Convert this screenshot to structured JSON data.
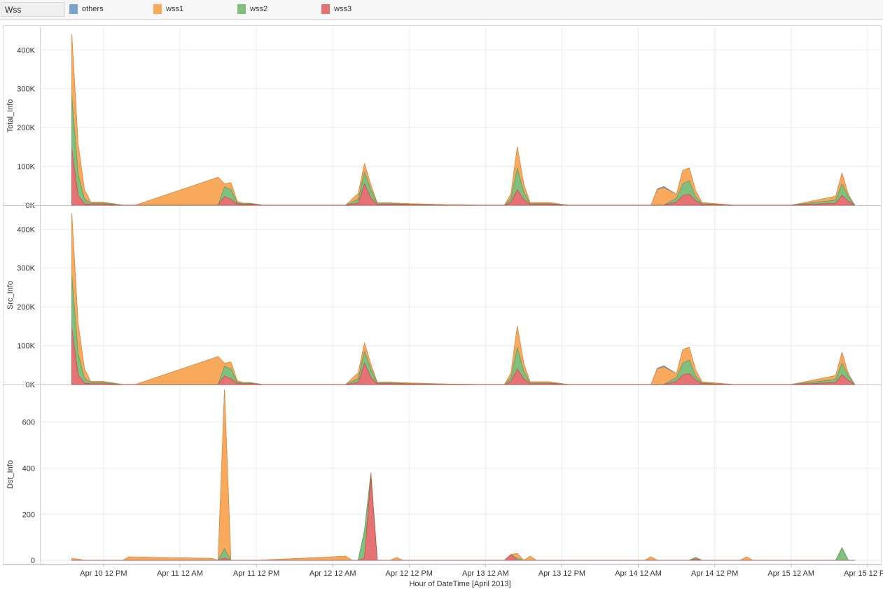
{
  "legend": {
    "title": "Wss",
    "items": [
      {
        "name": "others",
        "color": "#7ba4cc"
      },
      {
        "name": "wss1",
        "color": "#f9a95c"
      },
      {
        "name": "wss2",
        "color": "#80c07f"
      },
      {
        "name": "wss3",
        "color": "#e57373"
      }
    ]
  },
  "chart_data": {
    "type": "area",
    "stacked": true,
    "x_unit": "hour",
    "x_range": [
      "2013-04-10 02:00",
      "2013-04-15 14:00"
    ],
    "xlabel": "Hour of DateTime [April 2013]",
    "x_ticks": [
      {
        "at": "2013-04-10 12:00",
        "label": "Apr 10 12 PM"
      },
      {
        "at": "2013-04-11 00:00",
        "label": "Apr 11 12 AM"
      },
      {
        "at": "2013-04-11 12:00",
        "label": "Apr 11 12 PM"
      },
      {
        "at": "2013-04-12 00:00",
        "label": "Apr 12 12 AM"
      },
      {
        "at": "2013-04-12 12:00",
        "label": "Apr 12 12 PM"
      },
      {
        "at": "2013-04-13 00:00",
        "label": "Apr 13 12 AM"
      },
      {
        "at": "2013-04-13 12:00",
        "label": "Apr 13 12 PM"
      },
      {
        "at": "2013-04-14 00:00",
        "label": "Apr 14 12 AM"
      },
      {
        "at": "2013-04-14 12:00",
        "label": "Apr 14 12 PM"
      },
      {
        "at": "2013-04-15 00:00",
        "label": "Apr 15 12 AM"
      },
      {
        "at": "2013-04-15 12:00",
        "label": "Apr 15 12 PM"
      }
    ],
    "grid": true,
    "panels": [
      {
        "ylabel": "Total_Info",
        "ylim": [
          0,
          460000
        ],
        "y_ticks": [
          {
            "value": 0,
            "label": "0K"
          },
          {
            "value": 100000,
            "label": "100K"
          },
          {
            "value": 200000,
            "label": "200K"
          },
          {
            "value": 300000,
            "label": "300K"
          },
          {
            "value": 400000,
            "label": "400K"
          }
        ],
        "x": [
          "2013-04-10 07:00",
          "2013-04-10 08:00",
          "2013-04-10 09:00",
          "2013-04-10 10:00",
          "2013-04-10 12:00",
          "2013-04-10 15:00",
          "2013-04-10 17:00",
          "2013-04-11 06:00",
          "2013-04-11 07:00",
          "2013-04-11 08:00",
          "2013-04-11 09:00",
          "2013-04-11 10:00",
          "2013-04-11 11:00",
          "2013-04-11 13:00",
          "2013-04-12 00:00",
          "2013-04-12 02:00",
          "2013-04-12 04:00",
          "2013-04-12 05:00",
          "2013-04-12 06:00",
          "2013-04-12 07:00",
          "2013-04-12 09:00",
          "2013-04-12 12:00",
          "2013-04-12 18:00",
          "2013-04-13 00:00",
          "2013-04-13 03:00",
          "2013-04-13 04:00",
          "2013-04-13 05:00",
          "2013-04-13 06:00",
          "2013-04-13 07:00",
          "2013-04-13 10:00",
          "2013-04-13 13:00",
          "2013-04-14 00:00",
          "2013-04-14 02:00",
          "2013-04-14 03:00",
          "2013-04-14 04:00",
          "2013-04-14 06:00",
          "2013-04-14 07:00",
          "2013-04-14 08:00",
          "2013-04-14 09:00",
          "2013-04-14 10:00",
          "2013-04-14 12:00",
          "2013-04-14 15:00",
          "2013-04-15 00:00",
          "2013-04-15 07:00",
          "2013-04-15 08:00",
          "2013-04-15 09:00",
          "2013-04-15 10:00"
        ],
        "series": [
          {
            "name": "wss3",
            "values": [
              145000,
              25000,
              4000,
              2000,
              2000,
              0,
              0,
              0,
              22000,
              15000,
              3000,
              1000,
              2000,
              0,
              0,
              0,
              5000,
              55000,
              18000,
              2000,
              2000,
              1000,
              0,
              0,
              0,
              8000,
              40000,
              15000,
              2000,
              2000,
              0,
              0,
              0,
              0,
              0,
              8000,
              25000,
              28000,
              12000,
              2000,
              1000,
              0,
              0,
              5000,
              25000,
              10000,
              0
            ]
          },
          {
            "name": "wss2",
            "values": [
              135000,
              55000,
              12000,
              3000,
              3000,
              0,
              0,
              0,
              25000,
              25000,
              3000,
              2000,
              2000,
              0,
              0,
              0,
              10000,
              30000,
              22000,
              2000,
              2000,
              1000,
              0,
              0,
              0,
              10000,
              55000,
              20000,
              2000,
              2000,
              0,
              0,
              0,
              0,
              0,
              10000,
              30000,
              35000,
              10000,
              2000,
              1000,
              0,
              0,
              8000,
              30000,
              12000,
              0
            ]
          },
          {
            "name": "wss1",
            "values": [
              160000,
              78000,
              24000,
              3000,
              3000,
              0,
              0,
              72000,
              8000,
              18000,
              4000,
              2000,
              1000,
              0,
              0,
              0,
              15000,
              22000,
              12000,
              2000,
              2000,
              2000,
              1000,
              0,
              0,
              12000,
              55000,
              20000,
              3000,
              3000,
              0,
              0,
              0,
              40000,
              45000,
              10000,
              35000,
              33000,
              16000,
              3000,
              2000,
              0,
              0,
              10000,
              28000,
              6000,
              0
            ]
          },
          {
            "name": "others",
            "values": [
              0,
              0,
              0,
              0,
              0,
              0,
              0,
              0,
              0,
              0,
              0,
              0,
              0,
              0,
              0,
              0,
              0,
              0,
              0,
              0,
              0,
              0,
              0,
              0,
              0,
              0,
              0,
              0,
              0,
              0,
              0,
              0,
              0,
              2000,
              3000,
              0,
              0,
              0,
              0,
              0,
              0,
              0,
              0,
              0,
              0,
              0,
              0
            ]
          }
        ]
      },
      {
        "ylabel": "Src_Info",
        "ylim": [
          0,
          460000
        ],
        "y_ticks": [
          {
            "value": 0,
            "label": "0K"
          },
          {
            "value": 100000,
            "label": "100K"
          },
          {
            "value": 200000,
            "label": "200K"
          },
          {
            "value": 300000,
            "label": "300K"
          },
          {
            "value": 400000,
            "label": "400K"
          }
        ],
        "x": [
          "2013-04-10 07:00",
          "2013-04-10 08:00",
          "2013-04-10 09:00",
          "2013-04-10 10:00",
          "2013-04-10 12:00",
          "2013-04-10 15:00",
          "2013-04-10 17:00",
          "2013-04-11 06:00",
          "2013-04-11 07:00",
          "2013-04-11 08:00",
          "2013-04-11 09:00",
          "2013-04-11 10:00",
          "2013-04-11 11:00",
          "2013-04-11 13:00",
          "2013-04-12 00:00",
          "2013-04-12 02:00",
          "2013-04-12 04:00",
          "2013-04-12 05:00",
          "2013-04-12 06:00",
          "2013-04-12 07:00",
          "2013-04-12 09:00",
          "2013-04-12 12:00",
          "2013-04-12 18:00",
          "2013-04-13 00:00",
          "2013-04-13 03:00",
          "2013-04-13 04:00",
          "2013-04-13 05:00",
          "2013-04-13 06:00",
          "2013-04-13 07:00",
          "2013-04-13 10:00",
          "2013-04-13 13:00",
          "2013-04-14 00:00",
          "2013-04-14 02:00",
          "2013-04-14 03:00",
          "2013-04-14 04:00",
          "2013-04-14 06:00",
          "2013-04-14 07:00",
          "2013-04-14 08:00",
          "2013-04-14 09:00",
          "2013-04-14 10:00",
          "2013-04-14 12:00",
          "2013-04-14 15:00",
          "2013-04-15 00:00",
          "2013-04-15 07:00",
          "2013-04-15 08:00",
          "2013-04-15 09:00",
          "2013-04-15 10:00"
        ],
        "series": [
          {
            "name": "wss3",
            "values": [
              145000,
              25000,
              4000,
              2000,
              2000,
              0,
              0,
              0,
              22000,
              15000,
              3000,
              1000,
              2000,
              0,
              0,
              0,
              5000,
              55000,
              18000,
              2000,
              2000,
              1000,
              0,
              0,
              0,
              8000,
              40000,
              15000,
              2000,
              2000,
              0,
              0,
              0,
              0,
              0,
              8000,
              25000,
              28000,
              12000,
              2000,
              1000,
              0,
              0,
              5000,
              25000,
              10000,
              0
            ]
          },
          {
            "name": "wss2",
            "values": [
              135000,
              55000,
              12000,
              3000,
              3000,
              0,
              0,
              0,
              25000,
              25000,
              3000,
              2000,
              2000,
              0,
              0,
              0,
              10000,
              30000,
              22000,
              2000,
              2000,
              1000,
              0,
              0,
              0,
              10000,
              55000,
              20000,
              2000,
              2000,
              0,
              0,
              0,
              0,
              0,
              10000,
              30000,
              35000,
              10000,
              2000,
              1000,
              0,
              0,
              8000,
              30000,
              12000,
              0
            ]
          },
          {
            "name": "wss1",
            "values": [
              160000,
              78000,
              24000,
              3000,
              3000,
              0,
              0,
              72000,
              8000,
              18000,
              4000,
              2000,
              1000,
              0,
              0,
              0,
              15000,
              22000,
              12000,
              2000,
              2000,
              2000,
              1000,
              0,
              0,
              12000,
              55000,
              20000,
              3000,
              3000,
              0,
              0,
              0,
              40000,
              45000,
              10000,
              35000,
              33000,
              16000,
              3000,
              2000,
              0,
              0,
              10000,
              28000,
              6000,
              0
            ]
          },
          {
            "name": "others",
            "values": [
              0,
              0,
              0,
              0,
              0,
              0,
              0,
              0,
              0,
              0,
              0,
              0,
              0,
              0,
              0,
              0,
              0,
              0,
              0,
              0,
              0,
              0,
              0,
              0,
              0,
              0,
              0,
              0,
              0,
              0,
              0,
              0,
              0,
              2000,
              3000,
              0,
              0,
              0,
              0,
              0,
              0,
              0,
              0,
              0,
              0,
              0,
              0
            ]
          }
        ]
      },
      {
        "ylabel": "Dst_Info",
        "ylim": [
          -15,
          760
        ],
        "y_ticks": [
          {
            "value": 0,
            "label": "0"
          },
          {
            "value": 200,
            "label": "200"
          },
          {
            "value": 400,
            "label": "400"
          },
          {
            "value": 600,
            "label": "600"
          }
        ],
        "x": [
          "2013-04-10 07:00",
          "2013-04-10 08:00",
          "2013-04-10 09:00",
          "2013-04-10 15:00",
          "2013-04-10 16:00",
          "2013-04-11 05:00",
          "2013-04-11 06:00",
          "2013-04-11 07:00",
          "2013-04-11 08:00",
          "2013-04-11 12:00",
          "2013-04-12 00:00",
          "2013-04-12 02:00",
          "2013-04-12 03:00",
          "2013-04-12 04:00",
          "2013-04-12 05:00",
          "2013-04-12 06:00",
          "2013-04-12 07:00",
          "2013-04-12 09:00",
          "2013-04-12 10:00",
          "2013-04-12 11:00",
          "2013-04-13 03:00",
          "2013-04-13 04:00",
          "2013-04-13 05:00",
          "2013-04-13 06:00",
          "2013-04-13 07:00",
          "2013-04-13 08:00",
          "2013-04-13 09:00",
          "2013-04-14 01:00",
          "2013-04-14 02:00",
          "2013-04-14 03:00",
          "2013-04-14 08:00",
          "2013-04-14 09:00",
          "2013-04-14 10:00",
          "2013-04-14 16:00",
          "2013-04-14 17:00",
          "2013-04-14 18:00",
          "2013-04-15 07:00",
          "2013-04-15 08:00",
          "2013-04-15 09:00",
          "2013-04-15 10:00"
        ],
        "series": [
          {
            "name": "wss3",
            "values": [
              0,
              0,
              0,
              0,
              0,
              0,
              0,
              10,
              0,
              0,
              0,
              0,
              0,
              0,
              10,
              360,
              0,
              0,
              0,
              0,
              0,
              25,
              0,
              0,
              0,
              0,
              0,
              0,
              0,
              0,
              0,
              5,
              0,
              0,
              0,
              0,
              0,
              0,
              0,
              0
            ]
          },
          {
            "name": "wss2",
            "values": [
              0,
              0,
              0,
              0,
              0,
              0,
              0,
              40,
              0,
              0,
              0,
              0,
              0,
              0,
              120,
              10,
              0,
              0,
              0,
              0,
              0,
              0,
              8,
              0,
              0,
              0,
              0,
              0,
              0,
              0,
              0,
              8,
              0,
              0,
              0,
              0,
              0,
              55,
              0,
              0
            ]
          },
          {
            "name": "wss1",
            "values": [
              8,
              5,
              0,
              0,
              15,
              8,
              0,
              690,
              0,
              0,
              15,
              18,
              0,
              0,
              0,
              10,
              0,
              0,
              12,
              0,
              0,
              0,
              22,
              0,
              18,
              0,
              0,
              0,
              15,
              0,
              0,
              0,
              0,
              0,
              15,
              0,
              0,
              0,
              0,
              0
            ]
          },
          {
            "name": "others",
            "values": [
              0,
              0,
              0,
              0,
              0,
              0,
              0,
              0,
              0,
              0,
              0,
              0,
              0,
              0,
              0,
              0,
              0,
              0,
              0,
              0,
              0,
              0,
              0,
              0,
              0,
              0,
              0,
              0,
              0,
              0,
              0,
              0,
              0,
              0,
              0,
              0,
              0,
              0,
              0,
              0
            ]
          }
        ]
      }
    ]
  }
}
